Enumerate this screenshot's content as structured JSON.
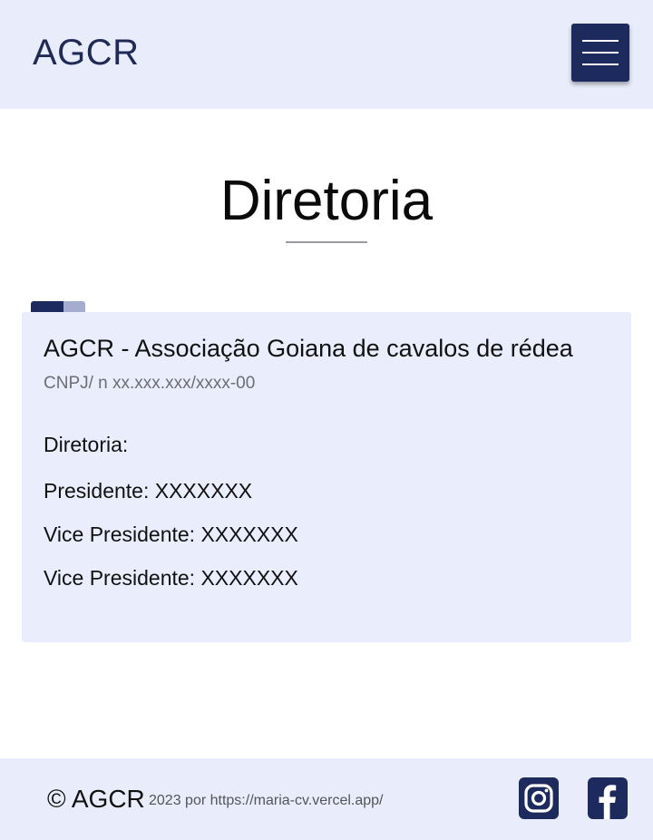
{
  "header": {
    "brand": "AGCR",
    "menu_icon": "hamburger-menu-icon"
  },
  "page": {
    "title": "Diretoria"
  },
  "card": {
    "title": "AGCR - Associação Goiana de cavalos de rédea",
    "subtitle": "CNPJ/ n xx.xxx.xxx/xxxx-00",
    "lines": [
      "Diretoria:",
      "Presidente: XXXXXXX",
      "Vice Presidente: XXXXXXX",
      "Vice Presidente: XXXXXXX"
    ]
  },
  "footer": {
    "copyright": "© AGCR",
    "credit": "2023 por https://maria-cv.vercel.app/",
    "social": [
      "instagram-icon",
      "facebook-icon"
    ]
  },
  "colors": {
    "header_bg": "#e9edfb",
    "accent_navy": "#1c2a5e",
    "card_bg": "#eaeefc",
    "brand_text": "#1f2a57"
  }
}
